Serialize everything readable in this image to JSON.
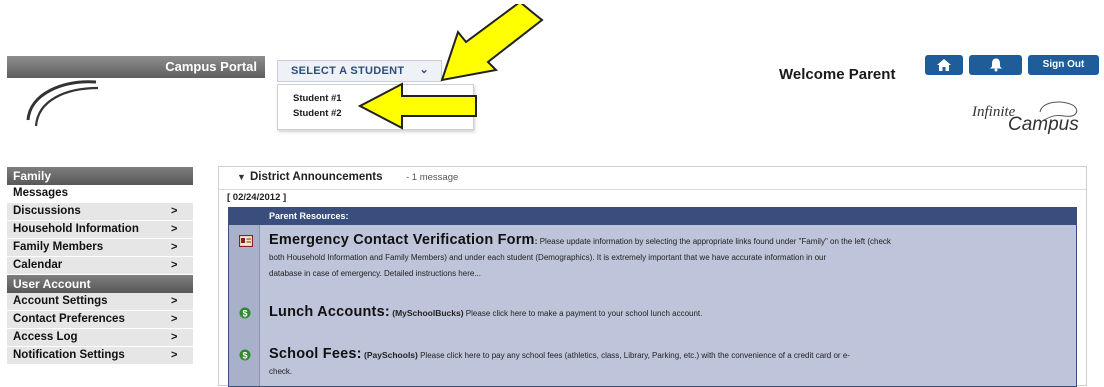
{
  "header": {
    "portal_title": "Campus Portal",
    "select_student_label": "SELECT A STUDENT",
    "select_chevron": "⌄",
    "students": [
      "Student #1",
      "Student #2"
    ],
    "welcome": "Welcome Parent",
    "sign_out": "Sign Out",
    "brand_top": "Infinite",
    "brand_bottom": "Campus"
  },
  "sidebar": {
    "sections": [
      {
        "title": "Family",
        "items": [
          {
            "label": "Messages",
            "chevron": ""
          },
          {
            "label": "Discussions",
            "chevron": ">"
          },
          {
            "label": "Household Information",
            "chevron": ">"
          },
          {
            "label": "Family Members",
            "chevron": ">"
          },
          {
            "label": "Calendar",
            "chevron": ">"
          }
        ]
      },
      {
        "title": "User Account",
        "items": [
          {
            "label": "Account Settings",
            "chevron": ">"
          },
          {
            "label": "Contact Preferences",
            "chevron": ">"
          },
          {
            "label": "Access Log",
            "chevron": ">"
          },
          {
            "label": "Notification Settings",
            "chevron": ">"
          }
        ]
      }
    ]
  },
  "announcements": {
    "title": "District Announcements",
    "count": "- 1 message",
    "date": "[ 02/24/2012 ]",
    "section_title": "Parent Resources:",
    "entries": [
      {
        "icon": "contact-card-icon",
        "title": "Emergency Contact Verification Form",
        "tag": ":",
        "line1": " Please update information by selecting the appropriate links found under \"Family\" on the left (check",
        "line2": "both Household Information and Family Members) and under each student (Demographics). It is extremely important that we have accurate information in our",
        "line3": "database in case of emergency.  Detailed instructions here..."
      },
      {
        "icon": "dollar-icon",
        "title": "Lunch Accounts:",
        "tag": " (MySchoolBucks)",
        "line1": " Please click here to make a payment to your school lunch account.",
        "line2": "",
        "line3": ""
      },
      {
        "icon": "dollar-icon",
        "title": "School Fees:",
        "tag": " (PaySchools)",
        "line1": " Please click here to pay any school fees (athletics, class, Library, Parking, etc.) with the convenience of a credit card or e-",
        "line2": "check.",
        "line3": ""
      }
    ]
  },
  "colors": {
    "accent": "#1f5d9a",
    "panel_header": "#3a4e7e",
    "panel_body": "#bec4d9",
    "arrow": "#ffff00"
  }
}
